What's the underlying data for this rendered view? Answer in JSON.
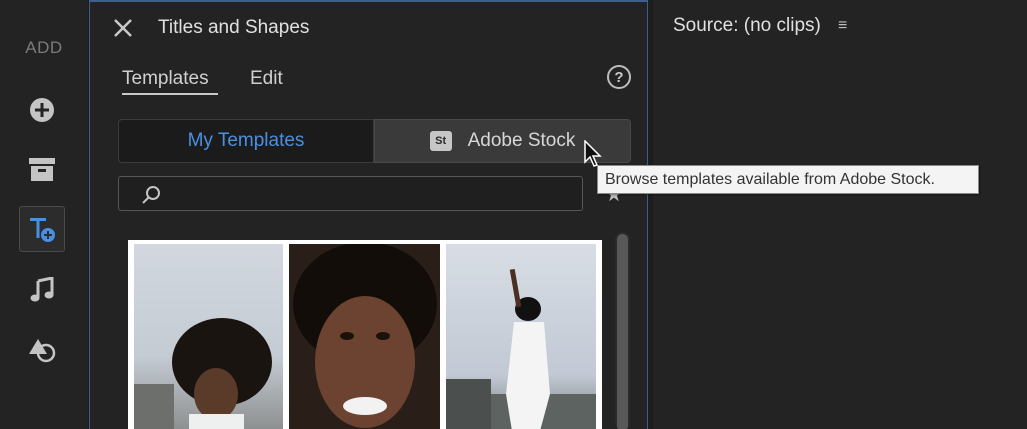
{
  "rail": {
    "title": "ADD",
    "buttons": [
      {
        "icon": "add-circle-icon"
      },
      {
        "icon": "archive-icon"
      },
      {
        "icon": "titles-icon",
        "active": true
      },
      {
        "icon": "music-icon"
      },
      {
        "icon": "shapes-icon"
      }
    ]
  },
  "panel": {
    "title": "Titles and Shapes",
    "tabs": [
      {
        "label": "Templates",
        "active": true
      },
      {
        "label": "Edit"
      }
    ],
    "help": "?",
    "segments": {
      "my_templates": "My Templates",
      "stock_badge": "St",
      "adobe_stock": "Adobe Stock"
    },
    "search": {
      "placeholder": ""
    },
    "star": "★"
  },
  "source": {
    "title": "Source: (no clips)",
    "menu": "≡"
  },
  "tooltip": {
    "text": "Browse templates available from Adobe Stock."
  },
  "colors": {
    "accent": "#4a90e2",
    "panel_border": "#3c5f8f",
    "background": "#232323"
  }
}
